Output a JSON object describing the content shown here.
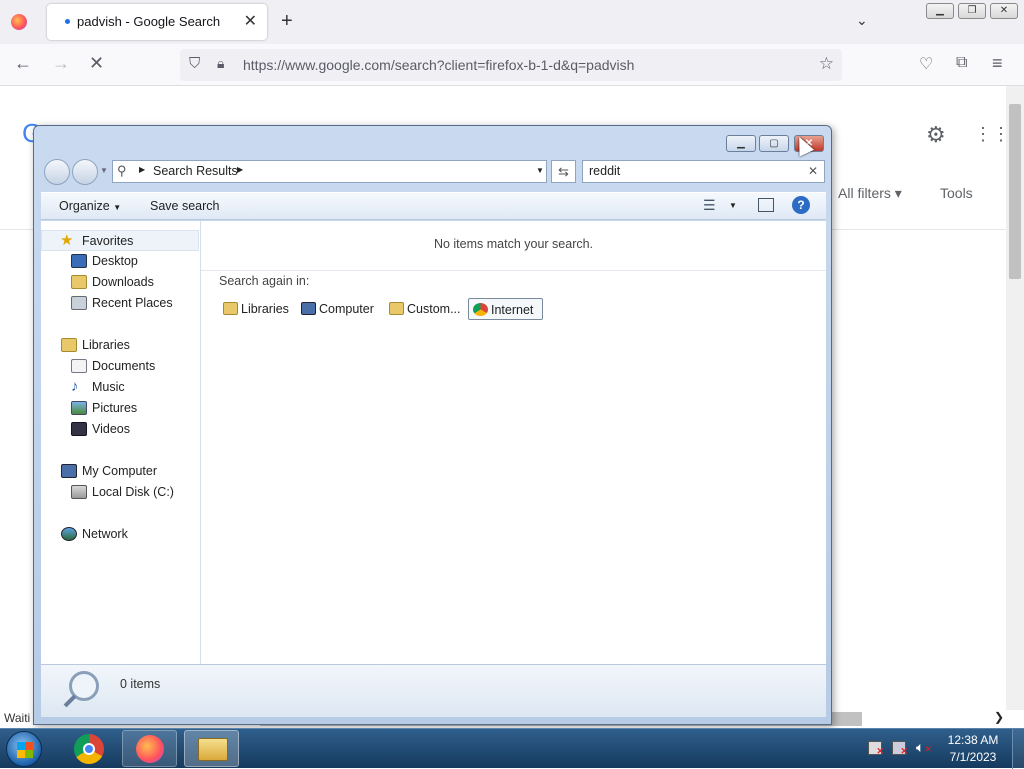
{
  "browser": {
    "tab_title": "padvish - Google Search",
    "url": "https://www.google.com/search?client=firefox-b-1-d&q=padvish",
    "status": "Waiti"
  },
  "google": {
    "all_filters": "All filters",
    "tools": "Tools"
  },
  "explorer": {
    "address_crumb": "Search Results",
    "search_value": "reddit",
    "toolbar": {
      "organize": "Organize",
      "save_search": "Save search"
    },
    "nav": {
      "favorites": "Favorites",
      "desktop": "Desktop",
      "downloads": "Downloads",
      "recent_places": "Recent Places",
      "libraries": "Libraries",
      "documents": "Documents",
      "music": "Music",
      "pictures": "Pictures",
      "videos": "Videos",
      "my_computer": "My Computer",
      "local_disk": "Local Disk (C:)",
      "network": "Network"
    },
    "no_items": "No items match your search.",
    "search_again_label": "Search again in:",
    "search_again": {
      "libraries": "Libraries",
      "computer": "Computer",
      "custom": "Custom...",
      "internet": "Internet"
    },
    "details_count": "0 items"
  },
  "taskbar": {
    "time": "12:38 AM",
    "date": "7/1/2023"
  }
}
